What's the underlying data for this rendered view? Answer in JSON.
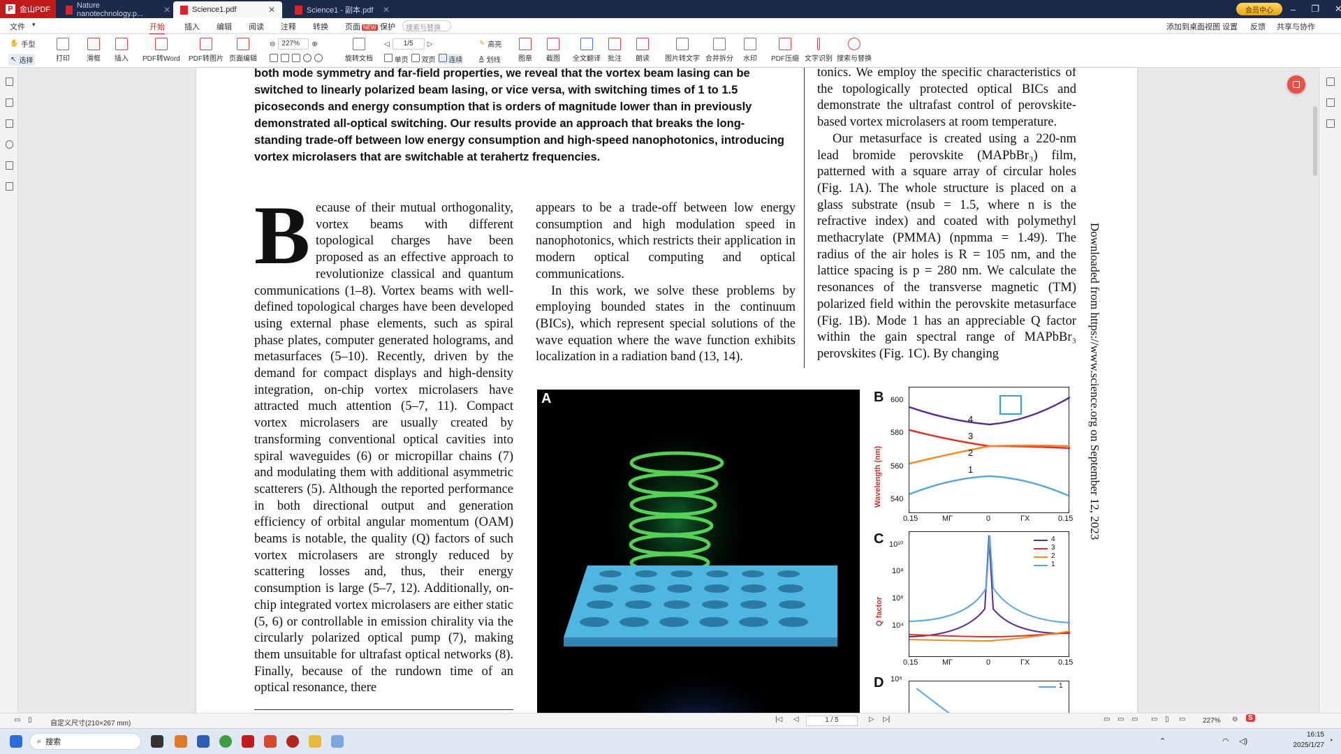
{
  "app": {
    "name": "金山PDF"
  },
  "tabs": [
    {
      "label": "Nature nanotechnology.p...",
      "active": false
    },
    {
      "label": "Science1.pdf",
      "active": true
    },
    {
      "label": "Science1 - 副本.pdf",
      "active": false
    }
  ],
  "member_badge": "会员中心",
  "menu": {
    "items": [
      "文件",
      "开始",
      "插入",
      "编辑",
      "阅读",
      "注释",
      "转换",
      "页面",
      "保护"
    ],
    "active": "开始",
    "new_badge": "NEW",
    "search_placeholder": "搜索与替换",
    "right": [
      "添加到桌面视图",
      "设置",
      "反馈",
      "共享与协作"
    ]
  },
  "toolbar": {
    "hand": "手型",
    "select": "选择",
    "print": "打印",
    "annotate": "滑框",
    "insert": "插入",
    "pdf_to_word": "PDF转Word",
    "pdf_to_image": "PDF转图片",
    "page_edit": "页面编辑",
    "zoom": "227%",
    "page_input": "1/5",
    "rotate": "旋转文档",
    "single": "单页",
    "double": "双页",
    "continuous": "连续",
    "highlight": "高亮",
    "underline": "划线",
    "stamp": "图章",
    "screenshot": "截图",
    "full_translate": "全文翻译",
    "comment": "批注",
    "read": "朗读",
    "extract": "图片转文字",
    "split": "合并拆分",
    "watermark": "水印",
    "pdf_compress": "PDF压缩",
    "text_recog": "文字识别",
    "search": "搜索与替换"
  },
  "document": {
    "abstract": "both mode symmetry and far-field properties, we reveal that the vortex beam lasing can be switched to linearly polarized beam lasing, or vice versa, with switching times of 1 to 1.5 picoseconds and energy consumption that is orders of magnitude lower than in previously demonstrated all-optical switching. Our results provide an approach that breaks the long-standing trade-off between low energy consumption and high-speed nanophotonics, introducing vortex microlasers that are switchable at terahertz frequencies.",
    "dropcap": "B",
    "col1": "ecause of their mutual orthogonality, vortex beams with different topological charges have been proposed as an effective approach to revolutionize classical and quantum communications (1–8). Vortex beams with well-defined topological charges have been developed using external phase elements, such as spiral phase plates, computer generated holograms, and metasurfaces (5–10). Recently, driven by the demand for compact displays and high-density integration, on-chip vortex microlasers have attracted much attention (5–7, 11). Compact vortex microlasers are usually created by transforming conventional optical cavities into spiral waveguides (6) or micropillar chains (7) and modulating them with additional asymmetric scatterers (5). Although the reported performance in both directional output and generation efficiency of orbital angular momentum (OAM) beams is notable, the quality (Q) factors of such vortex microlasers are strongly reduced by scattering losses and, thus, their energy consumption is large (5–7, 12). Additionally, on-chip integrated vortex microlasers are either static (5, 6) or controllable in emission chirality via the circularly polarized optical pump (7), making them unsuitable for ultrafast optical networks (8). Finally, because of the rundown time of an optical resonance, there",
    "col2_p1": "appears to be a trade-off between low energy consumption and high modulation speed in nanophotonics, which restricts their application in modern optical computing and optical communications.",
    "col2_p2": "In this work, we solve these problems by employing bounded states in the continuum (BICs), which represent special solutions of the wave equation where the wave function exhibits localization in a radiation band (13, 14).",
    "col3_p1": "tonics. We employ the specific characteristics of the topologically protected optical BICs and demonstrate the ultrafast control of perovskite-based vortex microlasers at room temperature.",
    "col3_p2": "Our metasurface is created using a 220-nm lead bromide perovskite (MAPbBr₃) film, patterned with a square array of circular holes (Fig. 1A). The whole structure is placed on a glass substrate (nsub = 1.5, where n is the refractive index) and coated with polymethyl methacrylate (PMMA) (npmma = 1.49). The radius of the air holes is R = 105 nm, and the lattice spacing is p = 280 nm. We calculate the resonances of the transverse magnetic (TM) polarized field within the perovskite metasurface (Fig. 1B). Mode 1 has an appreciable Q factor within the gain spectral range of MAPbBr₃ perovskites (Fig. 1C). By changing",
    "side_note": "Downloaded from https://www.science.org on September 12, 2023"
  },
  "figure": {
    "labels": {
      "A": "A",
      "B": "B",
      "C": "C",
      "D": "D"
    },
    "B_ylabel": "Wavelength (nm)",
    "B_yticks": [
      "600",
      "580",
      "560",
      "540"
    ],
    "B_xticks": [
      "0.15",
      "MΓ",
      "0",
      "ΓX",
      "0.15"
    ],
    "B_modes": [
      "4",
      "3",
      "2",
      "1"
    ],
    "C_ylabel": "Q factor",
    "C_yticks": [
      "10¹⁰",
      "10⁸",
      "10⁶",
      "10⁴"
    ],
    "C_xticks": [
      "0.15",
      "MΓ",
      "0",
      "ΓX",
      "0.15"
    ],
    "C_legend": [
      "4",
      "3",
      "2",
      "1"
    ],
    "D_ytick": "10⁹",
    "D_legend": "1",
    "colors": {
      "mode4": "#5b2d8c",
      "mode3": "#d9332c",
      "mode2": "#f08a24",
      "mode1": "#5aa6d8"
    }
  },
  "status": {
    "page_size": "自定义尺寸(210×267 mm)",
    "page_indicator": "1 / 5",
    "zoom": "227%"
  },
  "taskbar": {
    "search": "搜索",
    "time": "16:15",
    "date": "2025/1/27"
  }
}
